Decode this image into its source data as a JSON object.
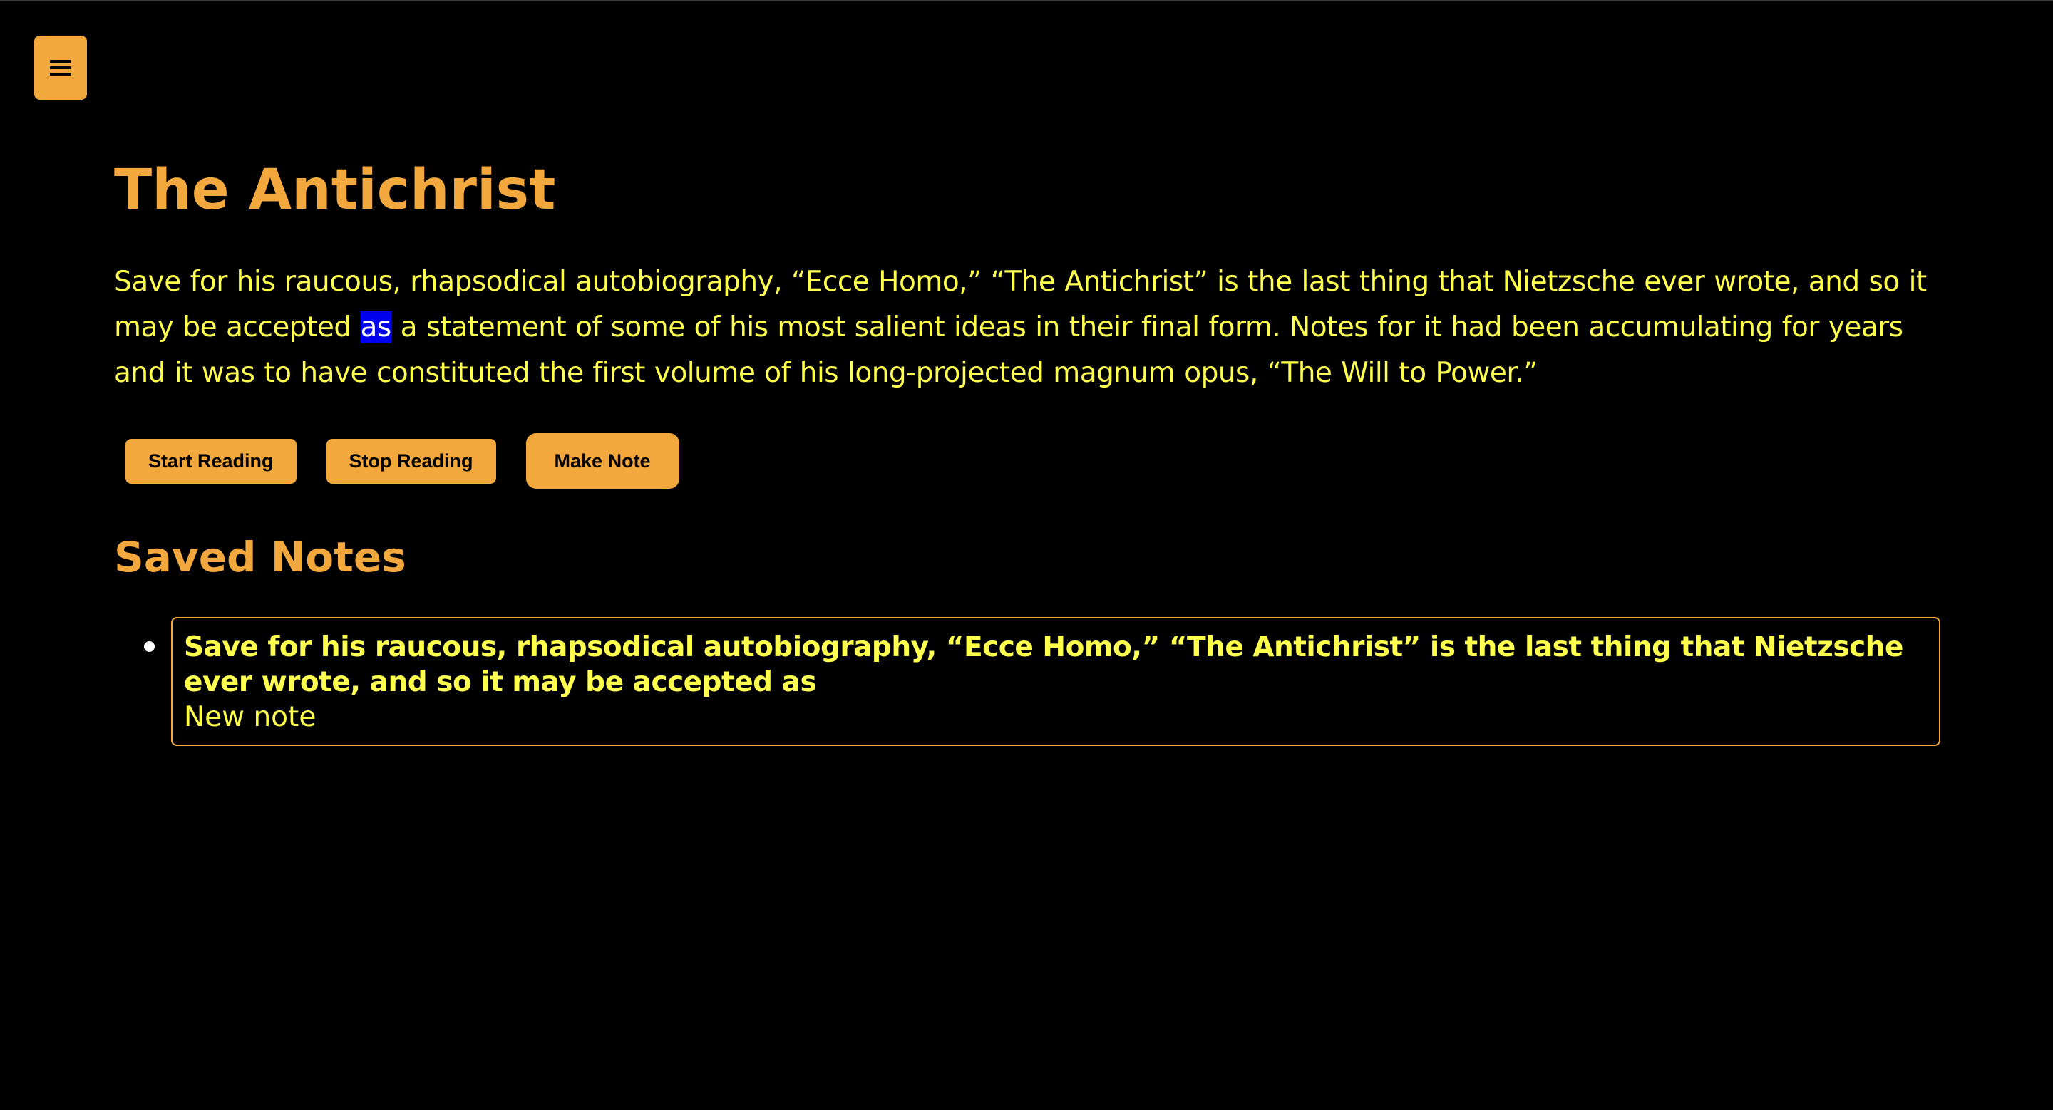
{
  "menu": {
    "icon": "hamburger-menu-icon"
  },
  "book": {
    "title": "The Antichrist",
    "passage_before": "Save for his raucous, rhapsodical autobiography, “Ecce Homo,” “The Antichrist” is the last thing that Nietzsche ever wrote, and so it may be accepted ",
    "highlighted_word": "as",
    "passage_after": " a statement of some of his most salient ideas in their final form. Notes for it had been accumulating for years and it was to have constituted the first volume of his long-projected magnum opus, “The Will to Power.”"
  },
  "controls": {
    "start_label": "Start Reading",
    "stop_label": "Stop Reading",
    "note_label": "Make Note"
  },
  "notes": {
    "heading": "Saved Notes",
    "items": [
      {
        "quote": "Save for his raucous, rhapsodical autobiography, “Ecce Homo,” “The Antichrist” is the last thing that Nietzsche ever wrote, and so it may be accepted as",
        "note": "New note"
      }
    ]
  },
  "colors": {
    "background": "#000000",
    "accent": "#f2a83c",
    "text": "#ffff4d",
    "highlight": "#0000ee"
  }
}
